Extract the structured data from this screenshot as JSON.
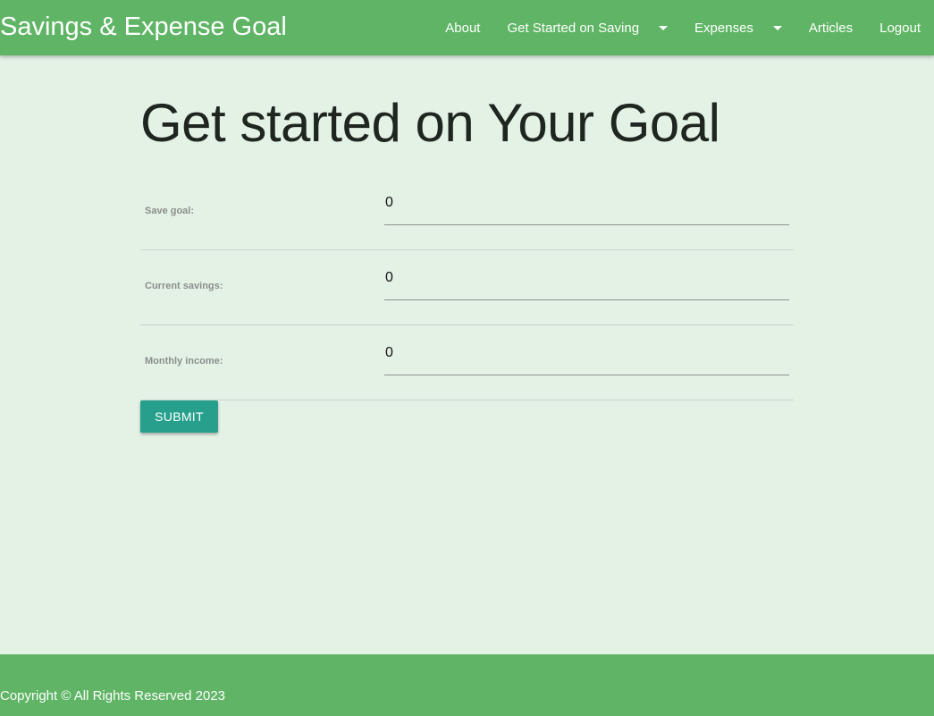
{
  "header": {
    "brand": "Savings & Expense Goal",
    "nav": [
      {
        "label": "About"
      },
      {
        "label": "Get Started on Saving",
        "dropdown": true
      },
      {
        "label": "Expenses",
        "dropdown": true
      },
      {
        "label": "Articles"
      },
      {
        "label": "Logout"
      }
    ]
  },
  "main": {
    "title": "Get started on Your Goal",
    "fields": [
      {
        "label": "Save goal:",
        "value": "0"
      },
      {
        "label": "Current savings:",
        "value": "0"
      },
      {
        "label": "Monthly income:",
        "value": "0"
      }
    ],
    "submit_label": "SUBMIT"
  },
  "footer": {
    "text": "Copyright © All Rights Reserved 2023"
  },
  "colors": {
    "header_bg": "#5fb565",
    "page_bg": "#e4f2e6",
    "button_bg": "#26a08c"
  }
}
